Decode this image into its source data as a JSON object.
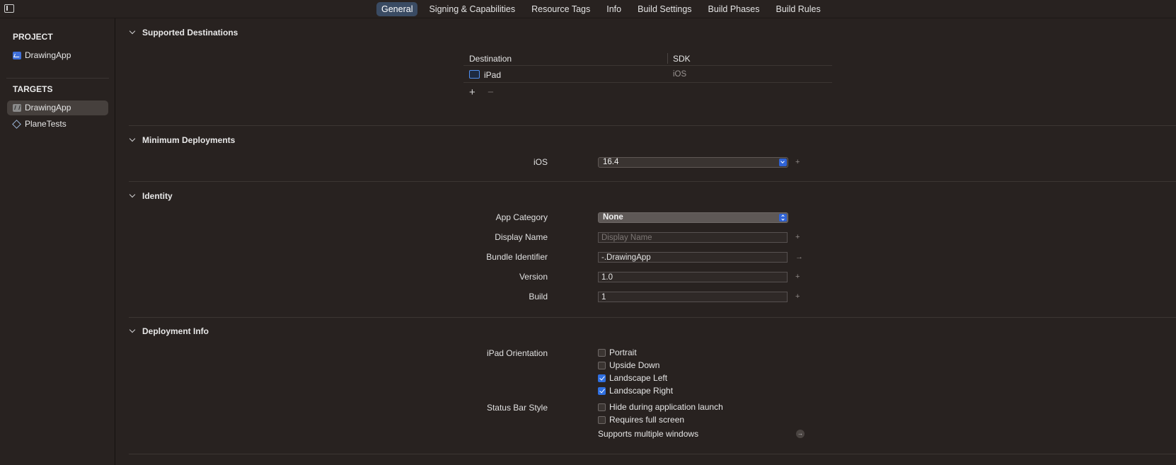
{
  "toolbar": {
    "tabs": [
      "General",
      "Signing & Capabilities",
      "Resource Tags",
      "Info",
      "Build Settings",
      "Build Phases",
      "Build Rules"
    ],
    "active_tab": "General"
  },
  "sidebar": {
    "project_heading": "PROJECT",
    "project_item": "DrawingApp",
    "targets_heading": "TARGETS",
    "targets": [
      "DrawingApp",
      "PlaneTests"
    ],
    "selected_target": "DrawingApp"
  },
  "sections": {
    "supported_destinations": {
      "title": "Supported Destinations",
      "col_destination": "Destination",
      "col_sdk": "SDK",
      "rows": [
        {
          "destination": "iPad",
          "sdk": "iOS"
        }
      ],
      "add_label": "+",
      "remove_label": "−"
    },
    "minimum_deployments": {
      "title": "Minimum Deployments",
      "ios_label": "iOS",
      "ios_value": "16.4"
    },
    "identity": {
      "title": "Identity",
      "app_category_label": "App Category",
      "app_category_value": "None",
      "display_name_label": "Display Name",
      "display_name_value": "",
      "display_name_placeholder": "Display Name",
      "bundle_identifier_label": "Bundle Identifier",
      "bundle_identifier_value": "-.DrawingApp",
      "version_label": "Version",
      "version_value": "1.0",
      "build_label": "Build",
      "build_value": "1"
    },
    "deployment_info": {
      "title": "Deployment Info",
      "ipad_orientation_label": "iPad Orientation",
      "orientations": [
        {
          "label": "Portrait",
          "checked": false
        },
        {
          "label": "Upside Down",
          "checked": false
        },
        {
          "label": "Landscape Left",
          "checked": true
        },
        {
          "label": "Landscape Right",
          "checked": true
        }
      ],
      "status_bar_style_label": "Status Bar Style",
      "status_options": [
        {
          "label": "Hide during application launch",
          "checked": false
        },
        {
          "label": "Requires full screen",
          "checked": false
        }
      ],
      "supports_multiple_windows": "Supports multiple windows"
    }
  },
  "icons": {
    "plus": "+",
    "arrow": "→"
  },
  "colors": {
    "background": "#282220",
    "accent": "#2f6fe0",
    "active_tab": "#3a4b63",
    "selected_sidebar": "#46403d"
  }
}
